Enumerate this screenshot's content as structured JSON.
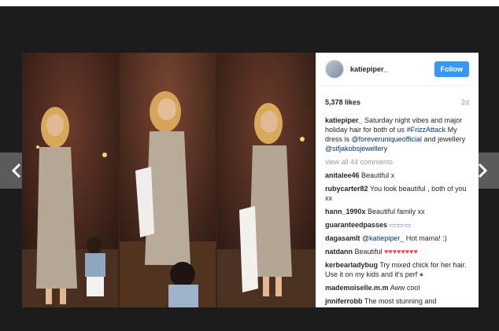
{
  "post": {
    "username": "katiepiper_",
    "follow_label": "Follow",
    "likes": "5,378 likes",
    "age": "2d",
    "caption": {
      "user": "katiepiper_",
      "text_a": "Saturday night vibes and major holiday hair for both of us ",
      "hashtag": "#FrizzAttack",
      "text_b": " My dress is ",
      "mention1": "@foreveruniqueofficial",
      "text_c": " and jewellery ",
      "mention2": "@sifjakobsjewellery"
    },
    "view_all": "view all 44 comments"
  },
  "comments": [
    {
      "user": "anitalee46",
      "text": "Beautiful x"
    },
    {
      "user": "rubycarter82",
      "text": "You look beautiful , both of you xx"
    },
    {
      "user": "hann_1990x",
      "text": "Beautiful family",
      "suffix": " xx"
    },
    {
      "user": "guaranteedpasses",
      "text": ""
    },
    {
      "user": "dagasamlt",
      "mention": "@katiepiper_",
      "text": " Hot mama! :)"
    },
    {
      "user": "natdann",
      "text": "Beautiful"
    },
    {
      "user": "kerbearladybug",
      "text": "Try mixed chick for her hair. Use it on my kids and it's perf"
    },
    {
      "user": "mademoiselle.m.m",
      "text": "Aww cool"
    },
    {
      "user": "jnniferrobb",
      "text": "The most stunning and inspirational person ever"
    }
  ],
  "icons": {
    "prev": "chevron-left-icon",
    "next": "chevron-right-icon"
  },
  "colors": {
    "backdrop": "#1c1c1d",
    "follow": "#3897f0",
    "link": "#003569",
    "heart": "#ed4956"
  }
}
